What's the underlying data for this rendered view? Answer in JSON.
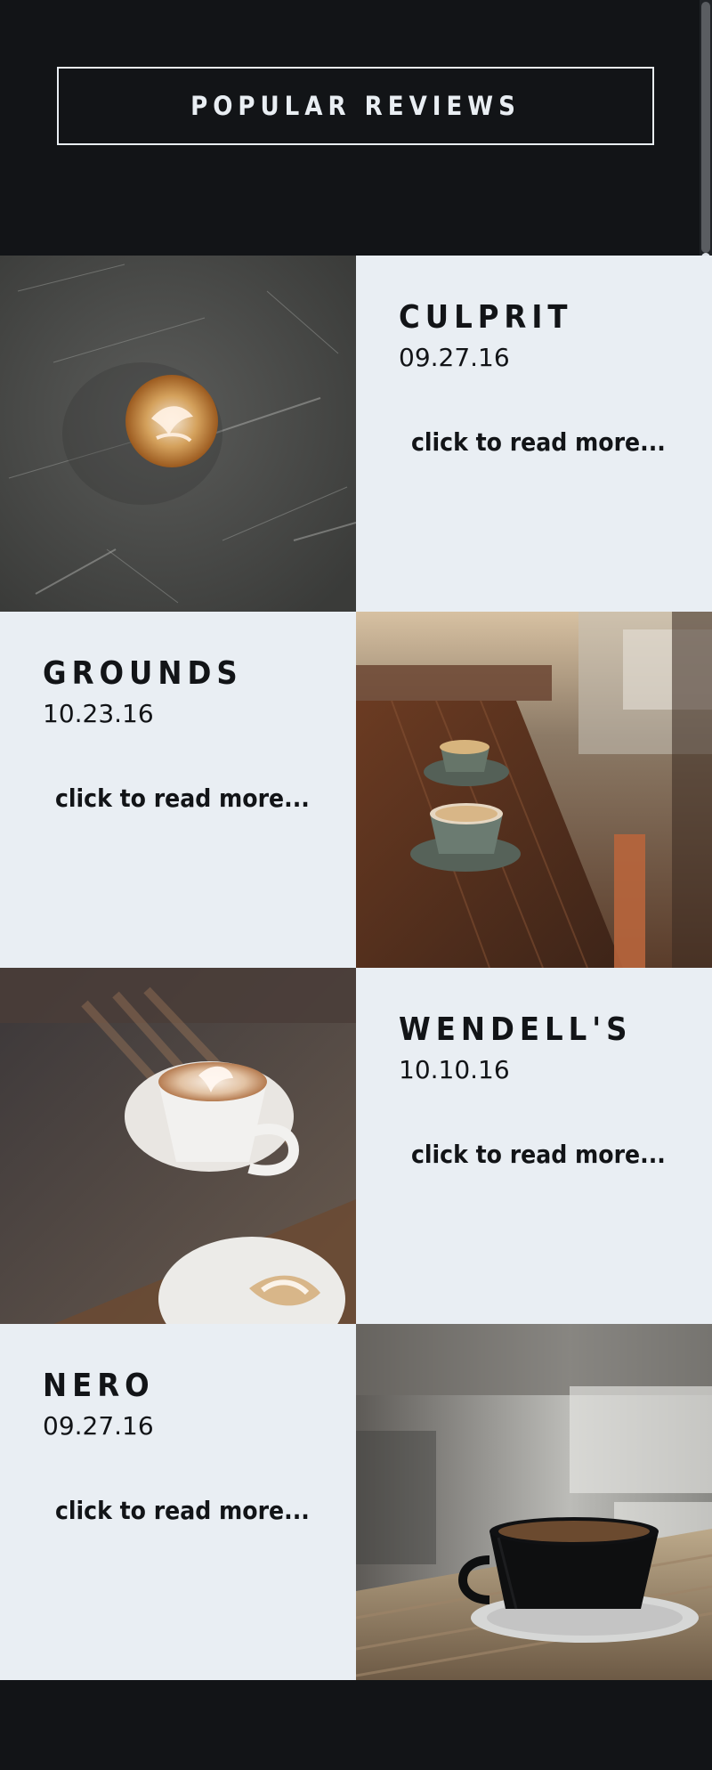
{
  "header": {
    "title": "POPULAR REVIEWS"
  },
  "reviews": [
    {
      "name": "CULPRIT",
      "date": "09.27.16",
      "more": "click to read more..."
    },
    {
      "name": "GROUNDS",
      "date": "10.23.16",
      "more": "click to read more..."
    },
    {
      "name": "WENDELL'S",
      "date": "10.10.16",
      "more": "click to read more..."
    },
    {
      "name": "NERO",
      "date": "09.27.16",
      "more": "click to read more..."
    }
  ],
  "colors": {
    "background": "#121417",
    "panel": "#E9EEF3",
    "text": "#121417"
  }
}
